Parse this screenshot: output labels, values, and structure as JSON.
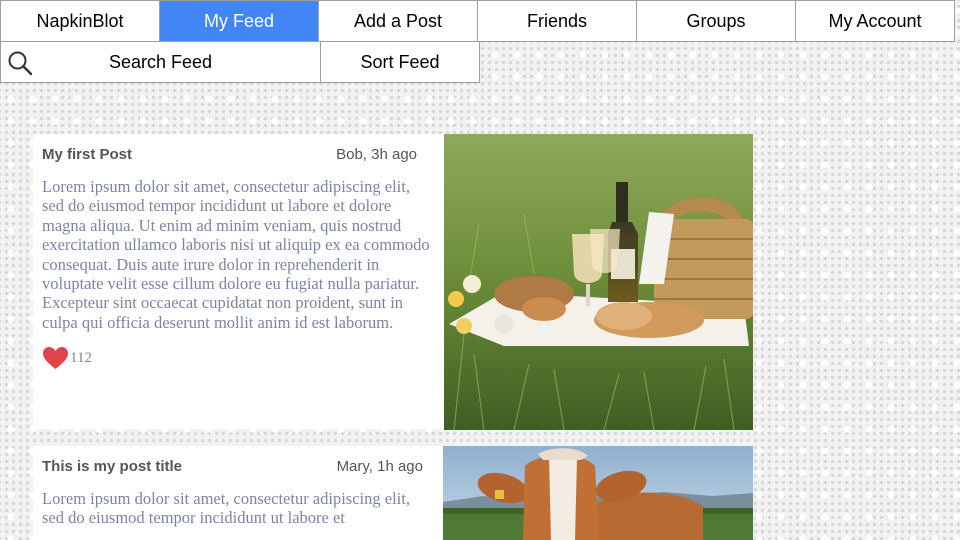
{
  "nav": {
    "items": [
      {
        "label": "NapkinBlot"
      },
      {
        "label": "My Feed"
      },
      {
        "label": "Add a Post"
      },
      {
        "label": "Friends"
      },
      {
        "label": "Groups"
      },
      {
        "label": "My Account"
      }
    ],
    "active_index": 1
  },
  "subbar": {
    "search_label": "Search Feed",
    "sort_label": "Sort Feed"
  },
  "posts": [
    {
      "title": "My first Post",
      "meta": "Bob, 3h ago",
      "body": "Lorem ipsum dolor sit amet, consectetur adipiscing elit, sed do eiusmod tempor incididunt ut labore et dolore magna aliqua. Ut enim ad minim veniam, quis nostrud exercitation ullamco laboris nisi ut aliquip ex ea commodo consequat. Duis aute irure dolor in reprehenderit in voluptate velit esse cillum dolore eu fugiat nulla pariatur. Excepteur sint occaecat cupidatat non proident, sunt in culpa qui officia deserunt mollit anim id est laborum.",
      "likes": "112",
      "image": "picnic-photo"
    },
    {
      "title": "This is my post title",
      "meta": "Mary, 1h ago",
      "body": "Lorem ipsum dolor sit amet, consectetur adipiscing elit, sed do eiusmod tempor incididunt ut labore et",
      "image": "cow-photo"
    }
  ],
  "colors": {
    "accent": "#4285f4",
    "heart": "#e0434b",
    "body_text": "#7b84a2"
  },
  "icons": {
    "search": "search-icon",
    "like": "heart-icon"
  }
}
